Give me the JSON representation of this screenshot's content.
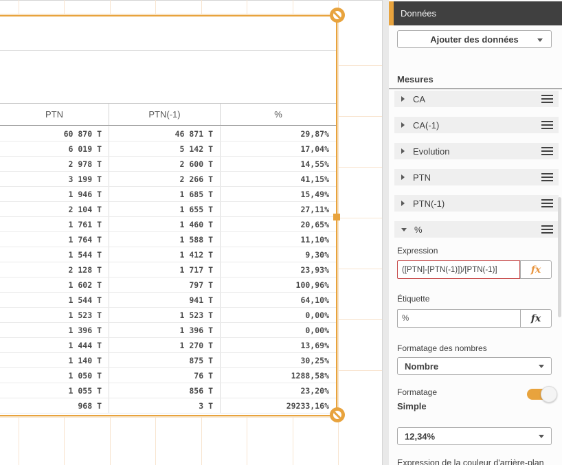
{
  "colors": {
    "accent": "#E8A33D",
    "accent_glow": "#F7E3C6",
    "error": "#C85050",
    "header_bg": "#404040",
    "grid": "#F8E4CF"
  },
  "table": {
    "columns": [
      "PTN",
      "PTN(-1)",
      "%"
    ],
    "rows": [
      [
        "60 870 T",
        "46 871 T",
        "29,87%"
      ],
      [
        "6 019 T",
        "5 142 T",
        "17,04%"
      ],
      [
        "2 978 T",
        "2 600 T",
        "14,55%"
      ],
      [
        "3 199 T",
        "2 266 T",
        "41,15%"
      ],
      [
        "1 946 T",
        "1 685 T",
        "15,49%"
      ],
      [
        "2 104 T",
        "1 655 T",
        "27,11%"
      ],
      [
        "1 761 T",
        "1 460 T",
        "20,65%"
      ],
      [
        "1 764 T",
        "1 588 T",
        "11,10%"
      ],
      [
        "1 544 T",
        "1 412 T",
        "9,30%"
      ],
      [
        "2 128 T",
        "1 717 T",
        "23,93%"
      ],
      [
        "1 602 T",
        "797 T",
        "100,96%"
      ],
      [
        "1 544 T",
        "941 T",
        "64,10%"
      ],
      [
        "1 523 T",
        "1 523 T",
        "0,00%"
      ],
      [
        "1 396 T",
        "1 396 T",
        "0,00%"
      ],
      [
        "1 444 T",
        "1 270 T",
        "13,69%"
      ],
      [
        "1 140 T",
        "875 T",
        "30,25%"
      ],
      [
        "1 050 T",
        "76 T",
        "1288,58%"
      ],
      [
        "1 055 T",
        "856 T",
        "23,20%"
      ],
      [
        "968 T",
        "3 T",
        "29233,16%"
      ]
    ]
  },
  "panel": {
    "title": "Données",
    "add_data_button": "Ajouter des données",
    "measures_label": "Mesures",
    "measures": [
      {
        "label": "CA",
        "expanded": false
      },
      {
        "label": "CA(-1)",
        "expanded": false
      },
      {
        "label": "Evolution",
        "expanded": false
      },
      {
        "label": "PTN",
        "expanded": false
      },
      {
        "label": "PTN(-1)",
        "expanded": false
      },
      {
        "label": "%",
        "expanded": true
      }
    ],
    "expression": {
      "label": "Expression",
      "value": "([PTN]-[PTN(-1)])/[PTN(-1)]",
      "fx_label": "fx"
    },
    "etiquette": {
      "label": "Étiquette",
      "value": "%",
      "fx_label": "fx"
    },
    "number_formatting": {
      "label": "Formatage des nombres",
      "value": "Nombre"
    },
    "formatting": {
      "label": "Formatage",
      "toggle_on": true,
      "mode": "Simple",
      "pattern": "12,34%"
    },
    "background_color_label": "Expression de la couleur d'arrière-plan"
  }
}
